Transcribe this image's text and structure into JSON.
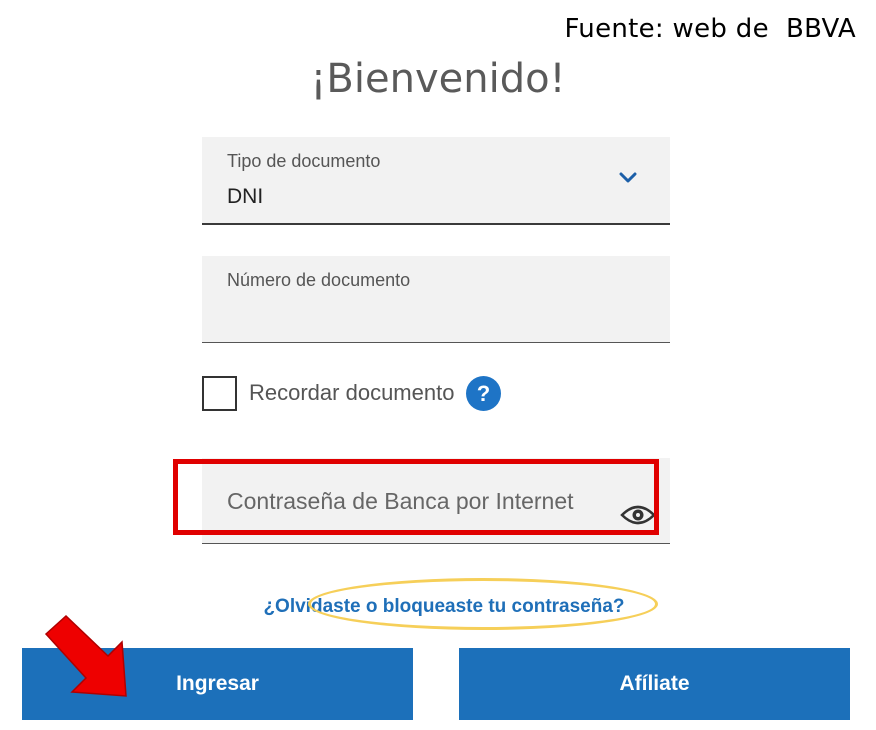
{
  "source_note": "Fuente: web de  BBVA",
  "title": "¡Bienvenido!",
  "doc_type": {
    "label": "Tipo de documento",
    "value": "DNI",
    "icon": "chevron-down-icon"
  },
  "doc_number": {
    "label": "Número de documento",
    "value": ""
  },
  "remember": {
    "label": "Recordar documento",
    "help": "?",
    "checked": false
  },
  "password": {
    "placeholder": "Contraseña de Banca por Internet",
    "icon": "eye-icon"
  },
  "forgot_link": "¿Olvidaste o bloqueaste tu contraseña?",
  "buttons": {
    "login": "Ingresar",
    "affiliate": "Afíliate"
  },
  "colors": {
    "primary": "#1c70ba",
    "link": "#1f6fb8",
    "highlight_red": "#e00000",
    "highlight_yellow": "#f6cf59"
  }
}
